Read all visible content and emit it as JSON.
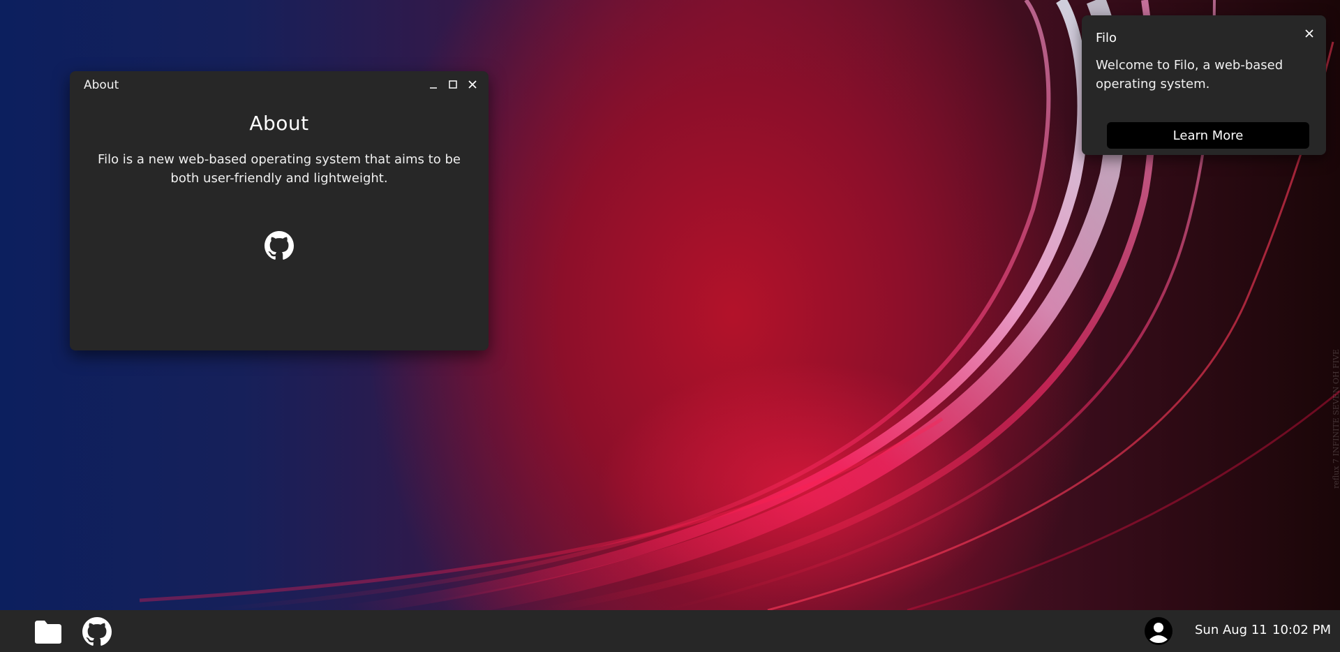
{
  "window": {
    "title": "About",
    "heading": "About",
    "description": "Filo is a new web-based operating system that aims to be both user-friendly and lightweight.",
    "controls": [
      "minimize-icon",
      "maximize-icon",
      "close-icon"
    ],
    "link_icon": "github-icon"
  },
  "notification": {
    "title": "Filo",
    "body": "Welcome to Filo, a web-based operating system.",
    "button_label": "Learn More",
    "close_icon": "close-icon"
  },
  "taskbar": {
    "apps": [
      {
        "icon": "folder-icon",
        "name": "Files"
      },
      {
        "icon": "github-icon",
        "name": "GitHub"
      }
    ],
    "user_icon": "user-avatar-icon",
    "date": "Sun Aug 11",
    "time": "10:02 PM"
  },
  "wallpaper": {
    "watermark": "reflux 7 INFINITE SEVEN OH FIVE"
  },
  "colors": {
    "panel": "#272727",
    "button": "#000000",
    "text": "#ffffff"
  }
}
